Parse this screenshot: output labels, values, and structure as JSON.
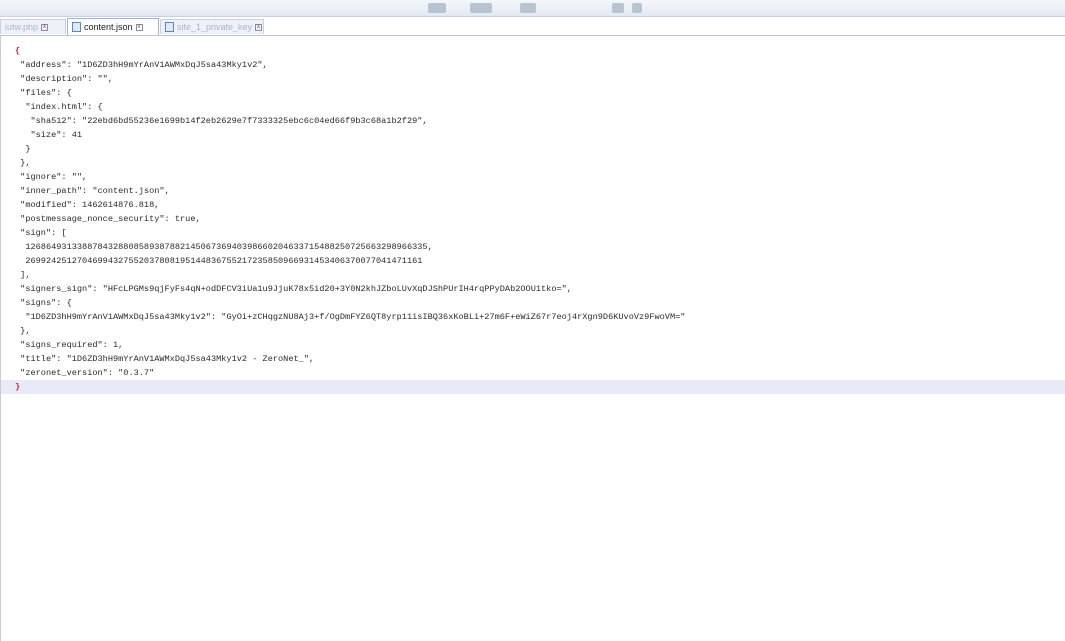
{
  "tabs": [
    {
      "label": "iutw.php",
      "active": false
    },
    {
      "label": "content.json",
      "active": true
    },
    {
      "label": "site_1_private_key",
      "active": false
    }
  ],
  "file": {
    "lines": [
      "{",
      " \"address\": \"1D6ZD3hH9mYrAnV1AWMxDqJ5sa43Mky1v2\",",
      " \"description\": \"\",",
      " \"files\": {",
      "  \"index.html\": {",
      "   \"sha512\": \"22ebd6bd55236e1699b14f2eb2629e7f7333325ebc6c04ed66f9b3c68a1b2f29\",",
      "   \"size\": 41",
      "  }",
      " },",
      " \"ignore\": \"\",",
      " \"inner_path\": \"content.json\",",
      " \"modified\": 1462614876.818,",
      " \"postmessage_nonce_security\": true,",
      " \"sign\": [",
      "  126864931338878432880858938788214506736940398660204633715488250725663298966335,",
      "  26992425127046994327552037808195144836755217235850966931453406370077041471161",
      " ],",
      " \"signers_sign\": \"HFcLPGMs9qjFyFs4qN+odDFCV3iUa1u9JjuK78x5id20+3Y0N2khJZboLUvXqDJShPUrIH4rqPPyDAb2OOU1tko=\",",
      " \"signs\": {",
      "  \"1D6ZD3hH9mYrAnV1AWMxDqJ5sa43Mky1v2\": \"GyOi+zCHqgzNU8Aj3+f/OgDmFYZ6QT8yrp11isIBQ36xKoBLi+27m6F+eWiZ67r7eoj4rXgn9D6KUvoVz9FwoVM=\"",
      " },",
      " \"signs_required\": 1,",
      " \"title\": \"1D6ZD3hH9mYrAnV1AWMxDqJ5sa43Mky1v2 - ZeroNet_\",",
      " \"zeronet_version\": \"0.3.7\"",
      "}"
    ]
  },
  "colors": {
    "current_line": "#e8eaf8",
    "brace": "#d9232e",
    "tab_border": "#9db2d4"
  }
}
